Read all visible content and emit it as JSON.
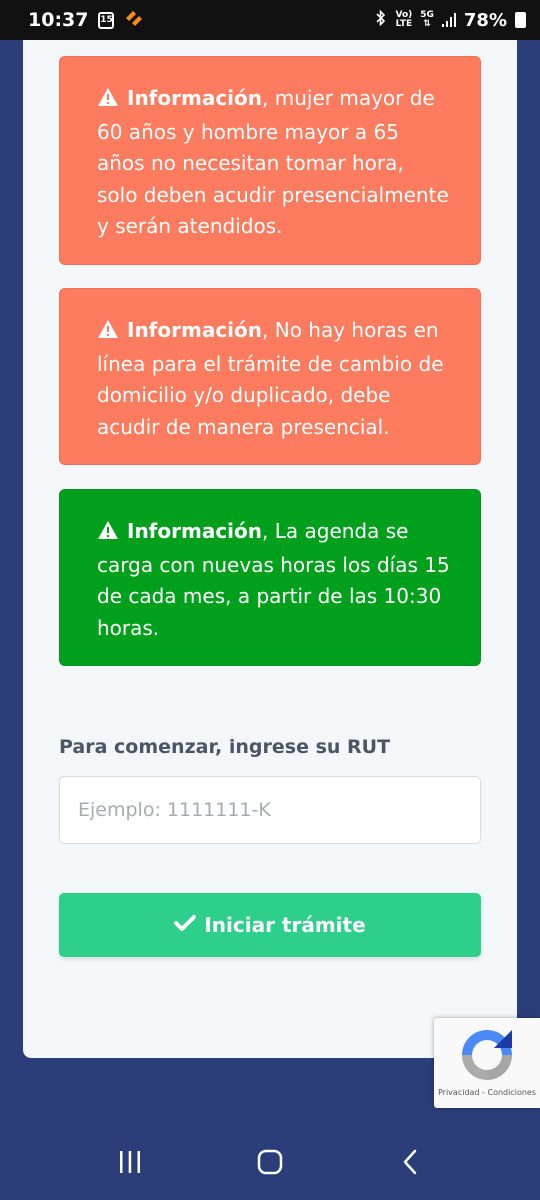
{
  "status_bar": {
    "time": "10:37",
    "calendar_day": "15",
    "network_top": "Vo)",
    "network_bottom": "LTE",
    "network_type": "5G",
    "battery": "78%"
  },
  "alerts": [
    {
      "title": "Información",
      "text": ", mujer mayor de 60 años y hombre mayor a 65 años no necesitan tomar hora, solo deben acudir presencialmente y serán atendidos.",
      "color": "#fd7b5e"
    },
    {
      "title": "Información",
      "text": ", No hay horas en línea para el trámite de cambio de domicilio y/o duplicado, debe acudir de manera presencial.",
      "color": "#fd7b5e"
    },
    {
      "title": "Información",
      "text": ", La agenda se carga con nuevas horas los días 15 de cada mes, a partir de las 10:30 horas.",
      "color": "#00a01c"
    }
  ],
  "form": {
    "label": "Para comenzar, ingrese su RUT",
    "rut_value": "",
    "rut_placeholder": "Ejemplo: 1111111-K",
    "submit_label": "Iniciar trámite"
  },
  "recaptcha": {
    "privacy": "Privacidad",
    "separator": "-",
    "terms": "Condiciones"
  },
  "colors": {
    "page_background": "#2c3e7a",
    "alert_warning": "#fd7b5e",
    "alert_success": "#00a01c",
    "submit_button": "#2ecf8b"
  },
  "icons": {
    "alert": "warning-triangle-icon",
    "submit": "check-icon",
    "recaptcha": "recaptcha-icon",
    "nav_recent": "recent-apps-icon",
    "nav_home": "home-icon",
    "nav_back": "back-icon"
  }
}
